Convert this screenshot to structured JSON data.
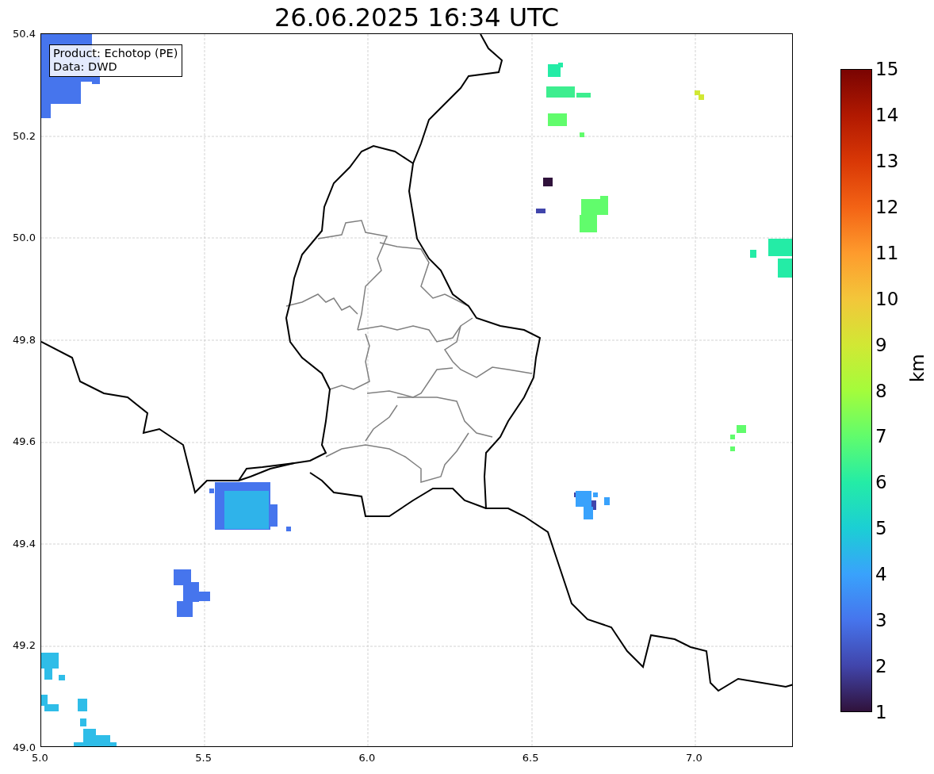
{
  "title": "26.06.2025 16:34 UTC",
  "info_box": [
    "Product: Echotop (PE)",
    "Data: DWD"
  ],
  "x_ticks": [
    "5.0",
    "5.5",
    "6.0",
    "6.5",
    "7.0"
  ],
  "y_ticks": [
    "50.4",
    "50.2",
    "50.0",
    "49.8",
    "49.6",
    "49.4",
    "49.2",
    "49.0"
  ],
  "colorbar": {
    "label": "km",
    "ticks": [
      "15",
      "14",
      "13",
      "12",
      "11",
      "10",
      "9",
      "8",
      "7",
      "6",
      "5",
      "4",
      "3",
      "2",
      "1"
    ]
  }
}
